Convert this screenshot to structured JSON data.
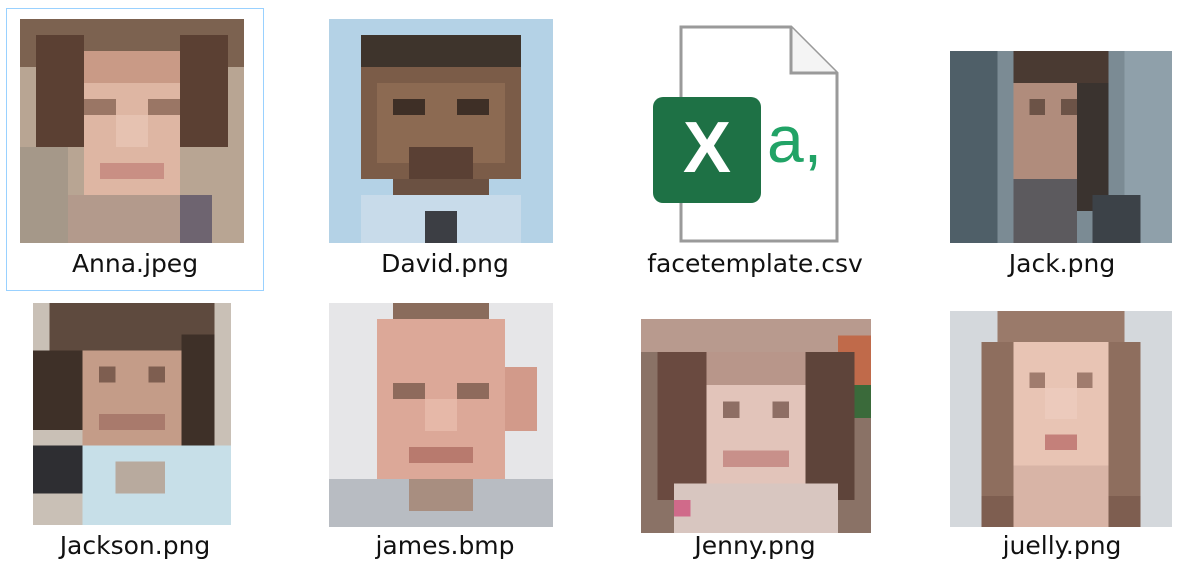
{
  "files": [
    {
      "name": "Anna.jpeg",
      "kind": "image",
      "selected": true,
      "icon": "photo-thumbnail-anna"
    },
    {
      "name": "David.png",
      "kind": "image",
      "selected": false,
      "icon": "photo-thumbnail-david"
    },
    {
      "name": "facetemplate.csv",
      "kind": "csv",
      "selected": false,
      "icon": "excel-csv-icon",
      "badge_letter": "X",
      "badge_text": "a,"
    },
    {
      "name": "Jack.png",
      "kind": "image",
      "selected": false,
      "icon": "photo-thumbnail-jack"
    },
    {
      "name": "Jackson.png",
      "kind": "image",
      "selected": false,
      "icon": "photo-thumbnail-jackson"
    },
    {
      "name": "james.bmp",
      "kind": "image",
      "selected": false,
      "icon": "photo-thumbnail-james"
    },
    {
      "name": "Jenny.png",
      "kind": "image",
      "selected": false,
      "icon": "photo-thumbnail-jenny"
    },
    {
      "name": "juelly.png",
      "kind": "image",
      "selected": false,
      "icon": "photo-thumbnail-juelly"
    }
  ],
  "colors": {
    "selection_border": "#99d1ff",
    "excel_green": "#1e7145",
    "csv_text_green": "#21a366"
  }
}
